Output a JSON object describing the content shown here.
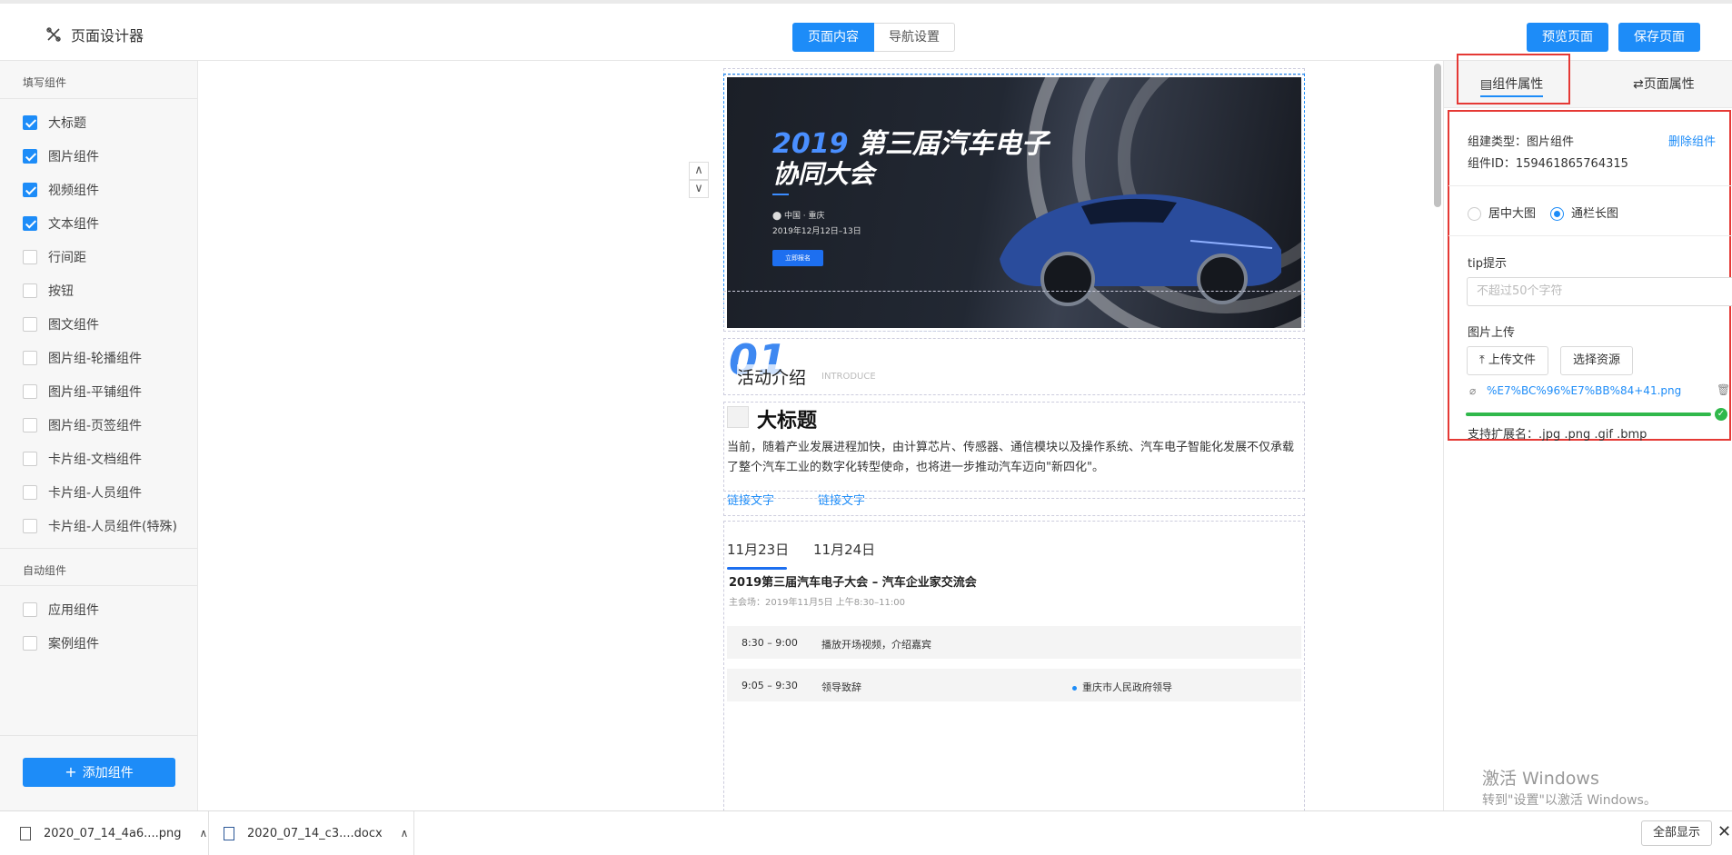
{
  "header": {
    "title": "页面设计器",
    "tabs": [
      "页面内容",
      "导航设置"
    ],
    "preview_label": "预览页面",
    "save_label": "保存页面"
  },
  "sidebar": {
    "group1_title": "填写组件",
    "group1_items": [
      {
        "label": "大标题",
        "checked": true
      },
      {
        "label": "图片组件",
        "checked": true
      },
      {
        "label": "视频组件",
        "checked": true
      },
      {
        "label": "文本组件",
        "checked": true
      },
      {
        "label": "行间距",
        "checked": false
      },
      {
        "label": "按钮",
        "checked": false
      },
      {
        "label": "图文组件",
        "checked": false
      },
      {
        "label": "图片组-轮播组件",
        "checked": false
      },
      {
        "label": "图片组-平铺组件",
        "checked": false
      },
      {
        "label": "图片组-页签组件",
        "checked": false
      },
      {
        "label": "卡片组-文档组件",
        "checked": false
      },
      {
        "label": "卡片组-人员组件",
        "checked": false
      },
      {
        "label": "卡片组-人员组件(特殊)",
        "checked": false
      }
    ],
    "group2_title": "自动组件",
    "group2_items": [
      {
        "label": "应用组件",
        "checked": false
      },
      {
        "label": "案例组件",
        "checked": false
      }
    ],
    "add_label": "添加组件"
  },
  "canvas": {
    "banner": {
      "year": "2019",
      "title_line1": "第三届汽车电子",
      "title_line2": "协同大会",
      "location": "中国 · 重庆",
      "date": "2019年12月12日–13日",
      "signup": "立即报名"
    },
    "section": {
      "num": "01",
      "name": "活动介绍",
      "en": "INTRODUCE"
    },
    "text_block": {
      "heading": "大标题",
      "paragraph": "当前，随着产业发展进程加快，由计算芯片、传感器、通信模块以及操作系统、汽车电子智能化发展不仅承载了整个汽车工业的数字化转型使命，也将进一步推动汽车迈向\"新四化\"。",
      "links": [
        "链接文字",
        "链接文字"
      ]
    },
    "agenda": {
      "tabs": [
        "11月23日",
        "11月24日"
      ],
      "title": "2019第三届汽车电子大会 – 汽车企业家交流会",
      "subtitle": "主会场：2019年11月5日 上午8:30–11:00",
      "rows": [
        {
          "time": "8:30 – 9:00",
          "item": "播放开场视频，介绍嘉宾",
          "person": ""
        },
        {
          "time": "9:05 – 9:30",
          "item": "领导致辞",
          "person": "重庆市人民政府领导"
        }
      ]
    }
  },
  "panel": {
    "tab_component": "组件属性",
    "tab_page": "页面属性",
    "type_label": "组建类型：图片组件",
    "delete_label": "删除组件",
    "id_label": "组件ID：159461865764315",
    "radio_options": [
      {
        "label": "居中大图",
        "selected": false
      },
      {
        "label": "通栏长图",
        "selected": true
      }
    ],
    "tip_label": "tip提示",
    "tip_placeholder": "不超过50个字符",
    "upload_label": "图片上传",
    "upload_button": "上传文件",
    "choose_button": "选择资源",
    "file_name": "%E7%BC%96%E7%BB%84+41.png",
    "upload_progress": 1.0,
    "ext_label": "支持扩展名：.jpg .png .gif .bmp",
    "watermark_line1": "激活 Windows",
    "watermark_line2": "转到\"设置\"以激活 Windows。"
  },
  "downloads": {
    "files": [
      "2020_07_14_4a6....png",
      "2020_07_14_c3....docx"
    ],
    "show_all": "全部显示"
  },
  "colors": {
    "accent": "#1d8cf8",
    "highlight_box": "#e53935",
    "success": "#30b84b"
  }
}
